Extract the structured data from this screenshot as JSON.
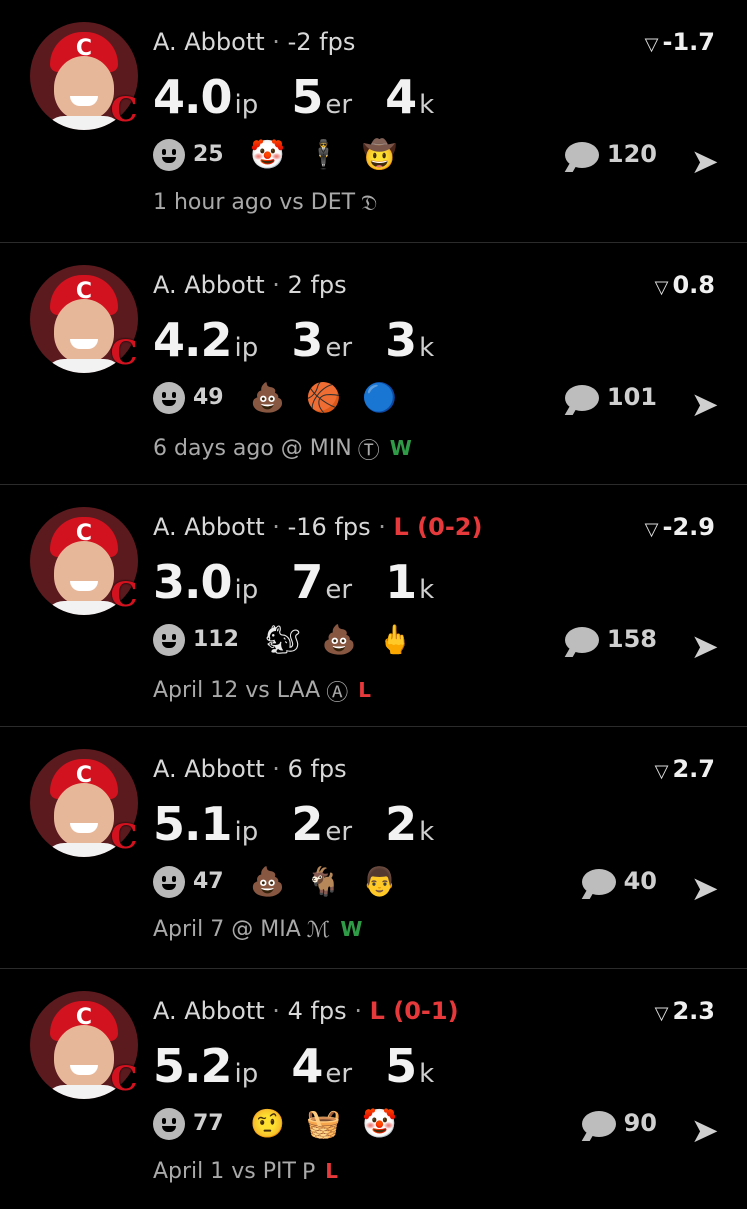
{
  "items": [
    {
      "player": "A. Abbott",
      "fps": "-2 fps",
      "result": "",
      "score": "-1.7",
      "ip": "4.0",
      "er": "5",
      "k": "4",
      "react_count": "25",
      "emojis": [
        "🤡",
        "🕴",
        "🤠"
      ],
      "replies": "120",
      "when": "1 hour ago vs DET",
      "opp_logo": "𝔇",
      "wl": ""
    },
    {
      "player": "A. Abbott",
      "fps": "2 fps",
      "result": "",
      "score": "0.8",
      "ip": "4.2",
      "er": "3",
      "k": "3",
      "react_count": "49",
      "emojis": [
        "💩",
        "🏀",
        "🔵"
      ],
      "replies": "101",
      "when": "6 days ago @ MIN",
      "opp_logo": "Ⓣ",
      "wl": "W"
    },
    {
      "player": "A. Abbott",
      "fps": "-16 fps",
      "result": "L (0-2)",
      "score": "-2.9",
      "ip": "3.0",
      "er": "7",
      "k": "1",
      "react_count": "112",
      "emojis": [
        "🐿",
        "💩",
        "🖕"
      ],
      "replies": "158",
      "when": "April 12 vs LAA",
      "opp_logo": "Ⓐ",
      "wl": "L"
    },
    {
      "player": "A. Abbott",
      "fps": "6 fps",
      "result": "",
      "score": "2.7",
      "ip": "5.1",
      "er": "2",
      "k": "2",
      "react_count": "47",
      "emojis": [
        "💩",
        "🐐",
        "👨"
      ],
      "replies": "40",
      "when": "April 7 @ MIA",
      "opp_logo": "ℳ",
      "wl": "W"
    },
    {
      "player": "A. Abbott",
      "fps": "4 fps",
      "result": "L (0-1)",
      "score": "2.3",
      "ip": "5.2",
      "er": "4",
      "k": "5",
      "react_count": "77",
      "emojis": [
        "🤨",
        "🧺",
        "🤡"
      ],
      "replies": "90",
      "when": "April 1 vs PIT",
      "opp_logo": "P",
      "wl": "L"
    }
  ],
  "labels": {
    "ip": "ip",
    "er": "er",
    "k": "k",
    "dot": "·",
    "score_icon": "▽",
    "share_icon": "➤",
    "team_badge": "C",
    "cap_logo": "C"
  },
  "colors": {
    "background": "#000000",
    "loss": "#e5393b",
    "win": "#2f9b47",
    "cap": "#d3121f"
  }
}
